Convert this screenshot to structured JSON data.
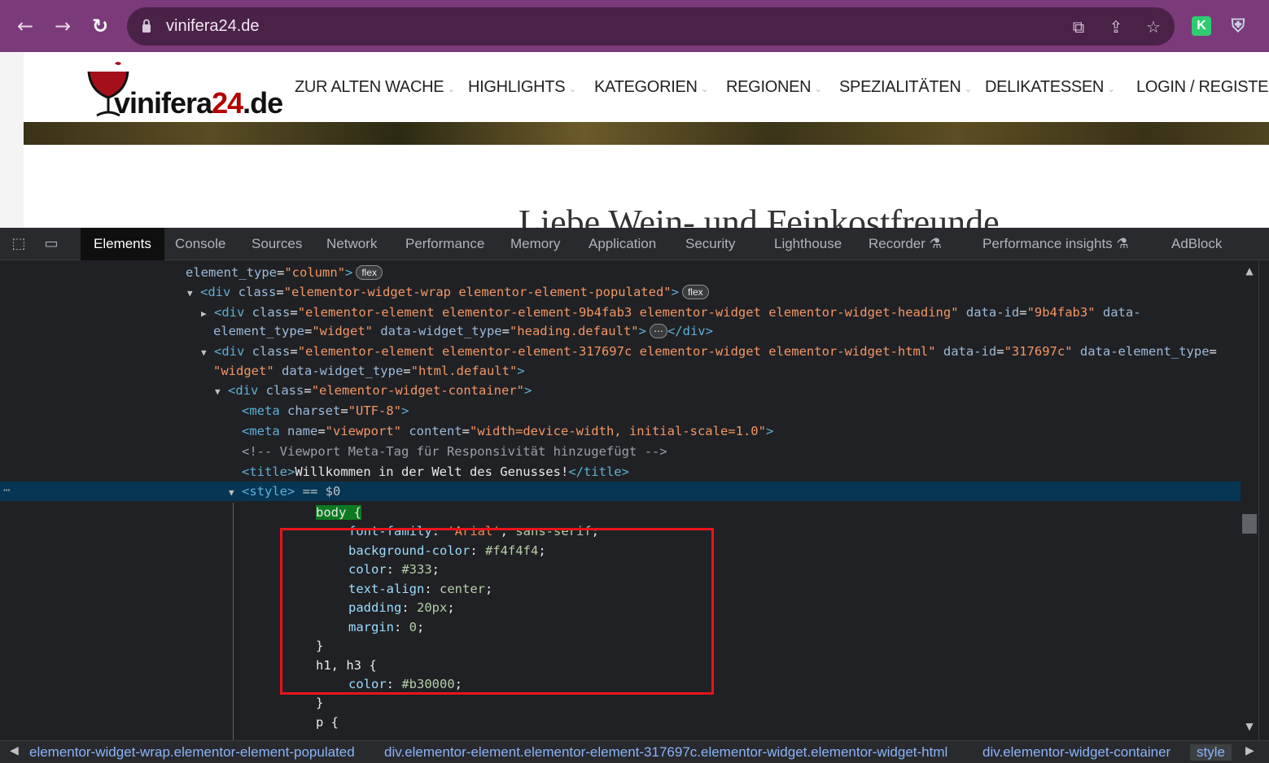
{
  "browser": {
    "url": "vinifera24.de",
    "back_icon": "←",
    "forward_icon": "→",
    "reload_icon": "↻",
    "translate_icon": "⧉",
    "share_icon": "⇪",
    "star_icon": "☆",
    "ext_k_label": "K",
    "ext_shield_label": "⛨",
    "colors": {
      "toolbar": "#7b3b7b",
      "omnibox": "#4a2248"
    }
  },
  "site": {
    "logo_name": "vinifera",
    "logo_num": "24",
    "logo_tld": ".de",
    "menu": [
      {
        "label": "ZUR ALTEN WACHE",
        "has_chevron": true
      },
      {
        "label": "HIGHLIGHTS",
        "has_chevron": true
      },
      {
        "label": "KATEGORIEN",
        "has_chevron": true
      },
      {
        "label": "REGIONEN",
        "has_chevron": true
      },
      {
        "label": "SPEZIALITÄTEN",
        "has_chevron": true
      },
      {
        "label": "DELIKATESSEN",
        "has_chevron": true
      },
      {
        "label": "LOGIN / REGISTER",
        "has_chevron": false
      }
    ],
    "chevron": "⌄",
    "hero_title": "Liebe Wein- und Feinkostfreunde"
  },
  "devtools": {
    "tabs": [
      "Elements",
      "Console",
      "Sources",
      "Network",
      "Performance",
      "Memory",
      "Application",
      "Security",
      "Lighthouse",
      "Recorder ⚗",
      "Performance insights ⚗",
      "AdBlock"
    ],
    "active_tab": "Elements",
    "inspect_icon": "⬚",
    "device_icon": "▭",
    "badge_flex": "flex",
    "ellipsis_badge": "⋯",
    "selected_marker": "== $0",
    "row_dots": "⋯",
    "code": {
      "l1_attr": "element_type",
      "l1_val": "\"column\"",
      "l2_class": "\"elementor-widget-wrap elementor-element-populated\"",
      "l3_class": "\"elementor-element elementor-element-9b4fab3 elementor-widget elementor-widget-heading\"",
      "l3_dataid": "\"9b4fab3\"",
      "l4_type": "\"widget\"",
      "l4_widget": "\"heading.default\"",
      "l5_class": "\"elementor-element elementor-element-317697c elementor-widget elementor-widget-html\"",
      "l5_dataid": "\"317697c\"",
      "l6_type": "\"widget\"",
      "l6_widget": "\"html.default\"",
      "l7_class": "\"elementor-widget-container\"",
      "l8_charset": "\"UTF-8\"",
      "l9_name": "\"viewport\"",
      "l9_content": "\"width=device-width, initial-scale=1.0\"",
      "l10_comment": "<!-- Viewport Meta-Tag für Responsivität hinzugefügt -->",
      "l11_title": "Willkommen in der Welt des Genusses!",
      "css_selector_body": "body {",
      "css_font_family_prop": "font-family",
      "css_font_family_str": "'Arial'",
      "css_font_family_rest": "sans-serif",
      "css_bg_prop": "background-color",
      "css_bg_val": "#f4f4f4",
      "css_color_prop": "color",
      "css_color_val": "#333",
      "css_align_prop": "text-align",
      "css_align_val": "center",
      "css_padding_prop": "padding",
      "css_padding_val": "20px",
      "css_margin_prop": "margin",
      "css_margin_val": "0",
      "css_close": "}",
      "css_h_selector": "h1, h3 {",
      "css_h_color_prop": "color",
      "css_h_color_val": "#b30000",
      "css_p_selector": "p {"
    },
    "breadcrumbs": [
      "elementor-widget-wrap.elementor-element-populated",
      "div.elementor-element.elementor-element-317697c.elementor-widget.elementor-widget-html",
      "div.elementor-widget-container",
      "style"
    ],
    "crumb_left": "◀",
    "crumb_right": "▶",
    "scroll_up": "▲",
    "scroll_down": "▼",
    "highlight_color": "#e8141a"
  }
}
